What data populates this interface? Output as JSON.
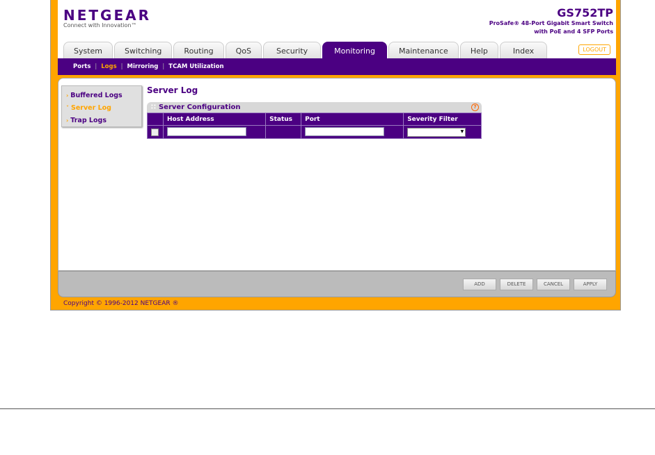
{
  "header": {
    "logo": "NETGEAR",
    "tagline": "Connect with Innovation™",
    "model": "GS752TP",
    "desc1": "ProSafe® 48-Port Gigabit Smart Switch",
    "desc2": "with PoE and 4 SFP Ports",
    "logout": "LOGOUT"
  },
  "tabs": [
    "System",
    "Switching",
    "Routing",
    "QoS",
    "Security",
    "Monitoring",
    "Maintenance",
    "Help",
    "Index"
  ],
  "subnav": [
    "Ports",
    "Logs",
    "Mirroring",
    "TCAM Utilization"
  ],
  "sidebar": [
    "Buffered Logs",
    "Server Log",
    "Trap Logs"
  ],
  "page_title": "Server Log",
  "panel": {
    "title": "Server Configuration",
    "help": "?",
    "columns": [
      "Host Address",
      "Status",
      "Port",
      "Severity Filter"
    ],
    "row": {
      "host": "",
      "status": "",
      "port": "",
      "severity": ""
    }
  },
  "buttons": {
    "add": "ADD",
    "delete": "DELETE",
    "cancel": "CANCEL",
    "apply": "APPLY"
  },
  "copyright": "Copyright © 1996-2012 NETGEAR ®"
}
